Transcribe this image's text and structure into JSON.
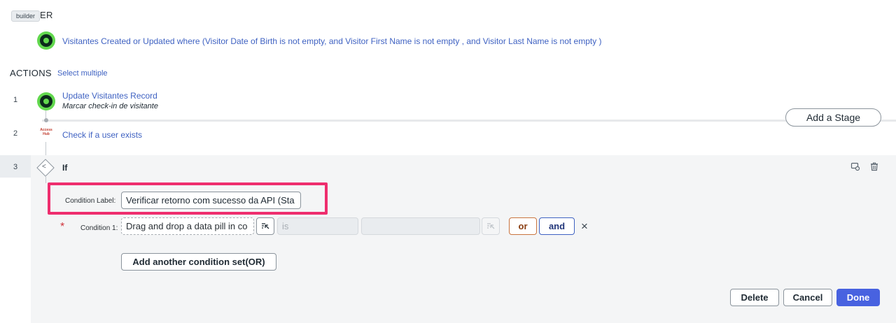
{
  "trigger": {
    "title": "ER",
    "tooltip": "builder",
    "description": "Visitantes Created or Updated where (Visitor Date of Birth is not empty, and Visitor First Name is not empty , and Visitor Last Name is not empty )"
  },
  "actions": {
    "title": "ACTIONS",
    "select_multiple": "Select multiple",
    "steps": [
      {
        "number": "1",
        "title": "Update Visitantes Record",
        "subtitle": "Marcar check-in de visitante"
      },
      {
        "number": "2",
        "title": "Check if a user exists",
        "icon_text": "Access Hub"
      },
      {
        "number": "3",
        "title": "If"
      }
    ],
    "add_stage": "Add a Stage"
  },
  "if_block": {
    "condition_label_text": "Condition Label:",
    "condition_label_value": "Verificar retorno com sucesso da API (Sta",
    "required_marker": "*",
    "condition1_label": "Condition 1:",
    "condition1_placeholder": "Drag and drop a data pill in co",
    "operator_placeholder": "is",
    "or_label": "or",
    "and_label": "and",
    "remove_glyph": "×",
    "add_condition_set": "Add another condition set(OR)",
    "delete_label": "Delete",
    "cancel_label": "Cancel",
    "done_label": "Done"
  },
  "icons": [
    "app-icon",
    "access-hub-icon",
    "if-diamond-icon",
    "data-pill-picker-icon",
    "copy-icon",
    "trash-icon",
    "close-icon"
  ],
  "colors": {
    "accent": "#4862e0",
    "highlight": "#ee2e6e",
    "link": "#3f62c2",
    "app_green": "#62d84e"
  }
}
